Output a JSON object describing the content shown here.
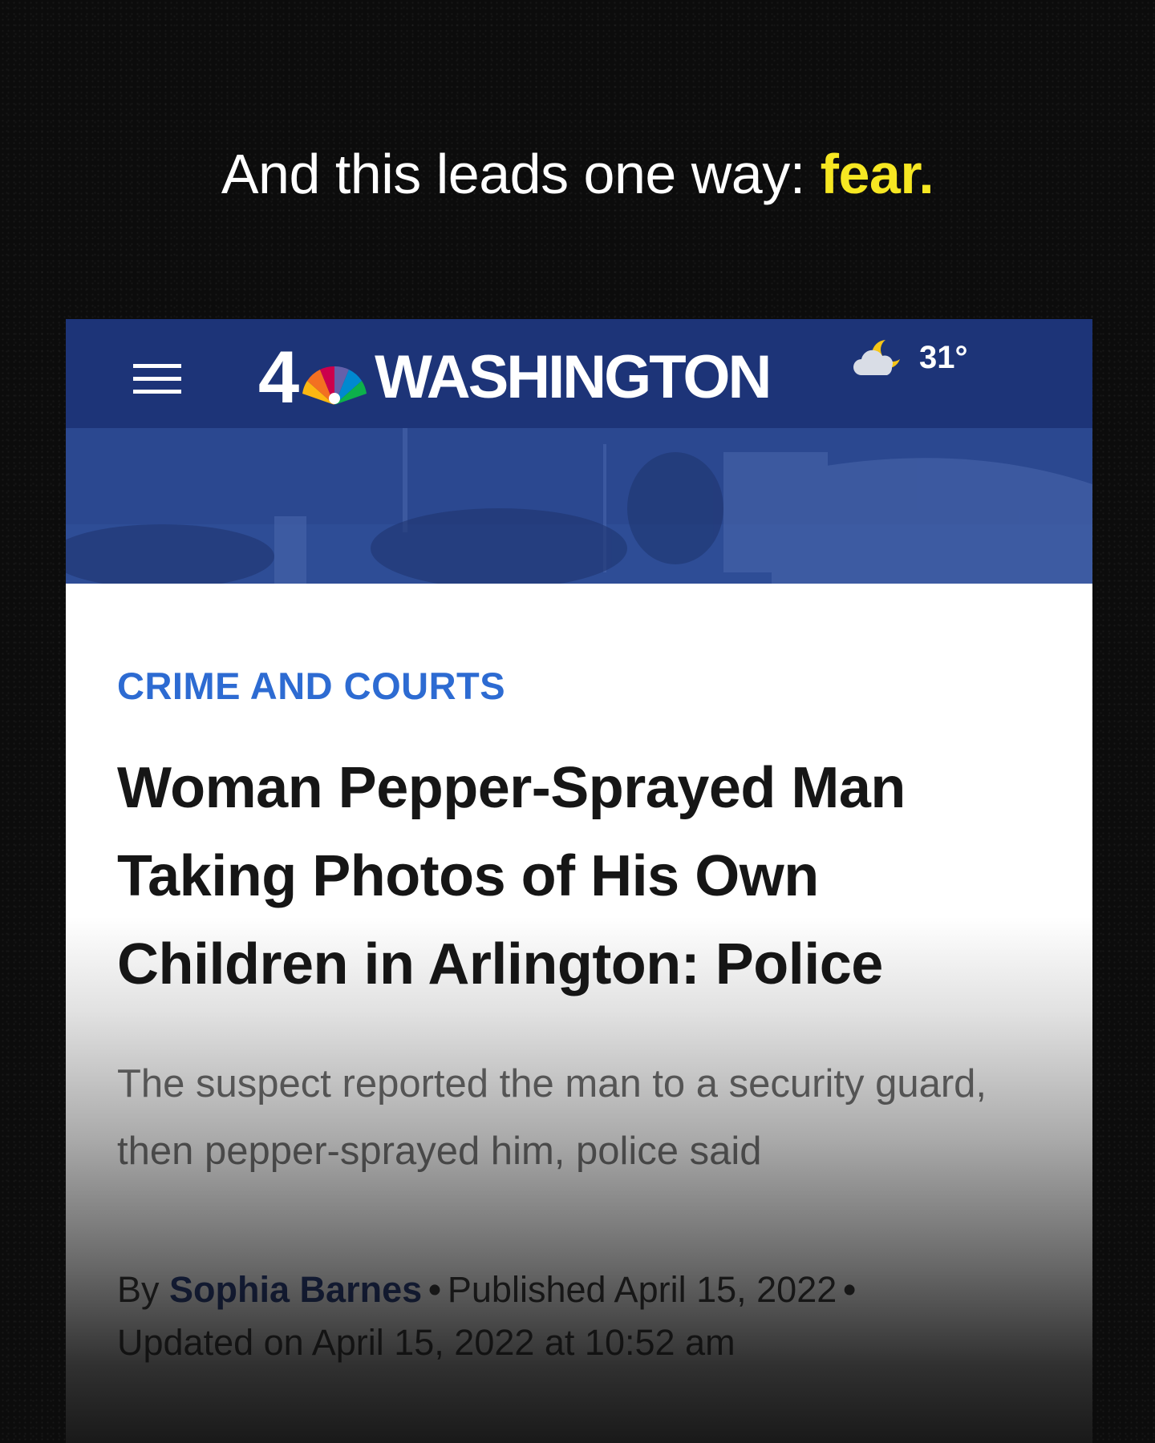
{
  "caption": {
    "text": "And this leads one way: ",
    "highlight": "fear."
  },
  "header": {
    "logo_number": "4",
    "logo_word": "WASHINGTON",
    "weather_icon": "partly-cloudy-night-icon",
    "temperature": "31°"
  },
  "article": {
    "category": "CRIME AND COURTS",
    "headline": "Woman Pepper-Sprayed Man Taking Photos of His Own Children in Arlington: Police",
    "dek": "The suspect reported the man to a security guard, then pepper-sprayed him, police said",
    "byline": {
      "prefix": "By",
      "author": "Sophia Barnes",
      "separator": "•",
      "published": "Published April 15, 2022",
      "updated": "Updated on April 15, 2022 at 10:52 am"
    }
  },
  "colors": {
    "header_bg": "#1d3478",
    "category": "#2d6bd2",
    "caption_highlight": "#f6e722"
  }
}
